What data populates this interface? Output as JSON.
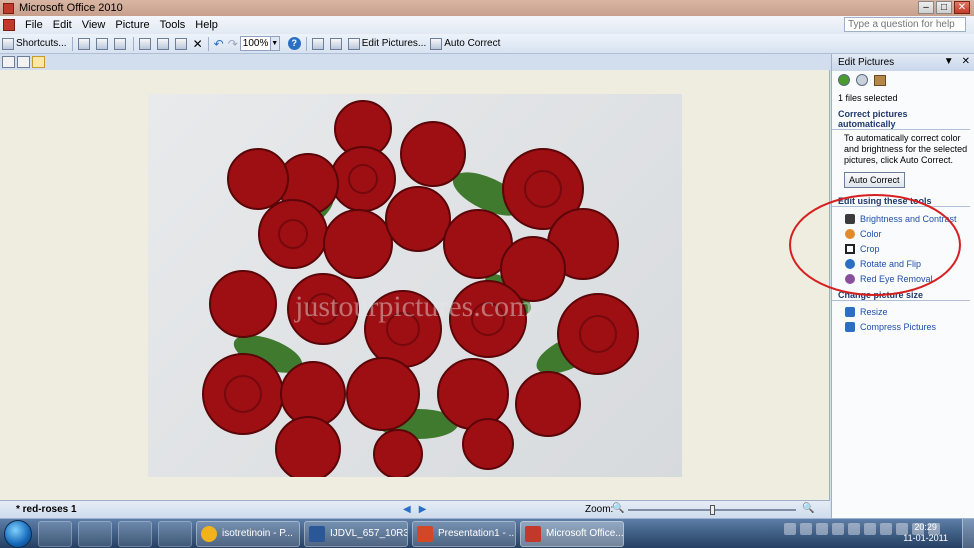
{
  "window": {
    "title": "Microsoft Office 2010"
  },
  "menu": {
    "items": [
      "File",
      "Edit",
      "View",
      "Picture",
      "Tools",
      "Help"
    ],
    "help_placeholder": "Type a question for help"
  },
  "toolbar": {
    "shortcuts_label": "Shortcuts...",
    "zoom_value": "100%",
    "edit_pictures_label": "Edit Pictures...",
    "auto_correct_label": "Auto Correct"
  },
  "photo": {
    "watermark": "justourpictures.com"
  },
  "status": {
    "document": "* red-roses 1",
    "zoom_label": "Zoom:",
    "zoom_level": 0.5
  },
  "task_pane": {
    "title": "Edit Pictures",
    "files_selected": "1 files selected",
    "auto_heading": "Correct pictures automatically",
    "auto_desc": "To automatically correct color and brightness for the selected pictures, click Auto Correct.",
    "auto_button": "Auto Correct",
    "tools_heading": "Edit using these tools",
    "tools": [
      {
        "label": "Brightness and Contrast",
        "icon": "brightness-contrast-icon",
        "color": "#3b3b3b"
      },
      {
        "label": "Color",
        "icon": "color-wheel-icon",
        "color": "#e08a2c"
      },
      {
        "label": "Crop",
        "icon": "crop-icon",
        "color": "#222222"
      },
      {
        "label": "Rotate and Flip",
        "icon": "rotate-icon",
        "color": "#2a6fc4"
      },
      {
        "label": "Red Eye Removal",
        "icon": "red-eye-icon",
        "color": "#8a4f9c"
      }
    ],
    "size_heading": "Change picture size",
    "size_tools": [
      {
        "label": "Resize",
        "icon": "resize-icon",
        "color": "#2a6fc4"
      },
      {
        "label": "Compress Pictures",
        "icon": "compress-icon",
        "color": "#2a6fc4"
      }
    ],
    "annotation_color": "#d62020"
  },
  "taskbar": {
    "tasks": [
      {
        "label": "isotretinoin - P...",
        "color": "#f2b21b"
      },
      {
        "label": "IJDVL_657_10R3 ...",
        "color": "#2b5797"
      },
      {
        "label": "Presentation1 - ...",
        "color": "#d24726"
      },
      {
        "label": "Microsoft Office...",
        "color": "#c0392b"
      }
    ],
    "time": "20:29",
    "date": "11-01-2011"
  }
}
